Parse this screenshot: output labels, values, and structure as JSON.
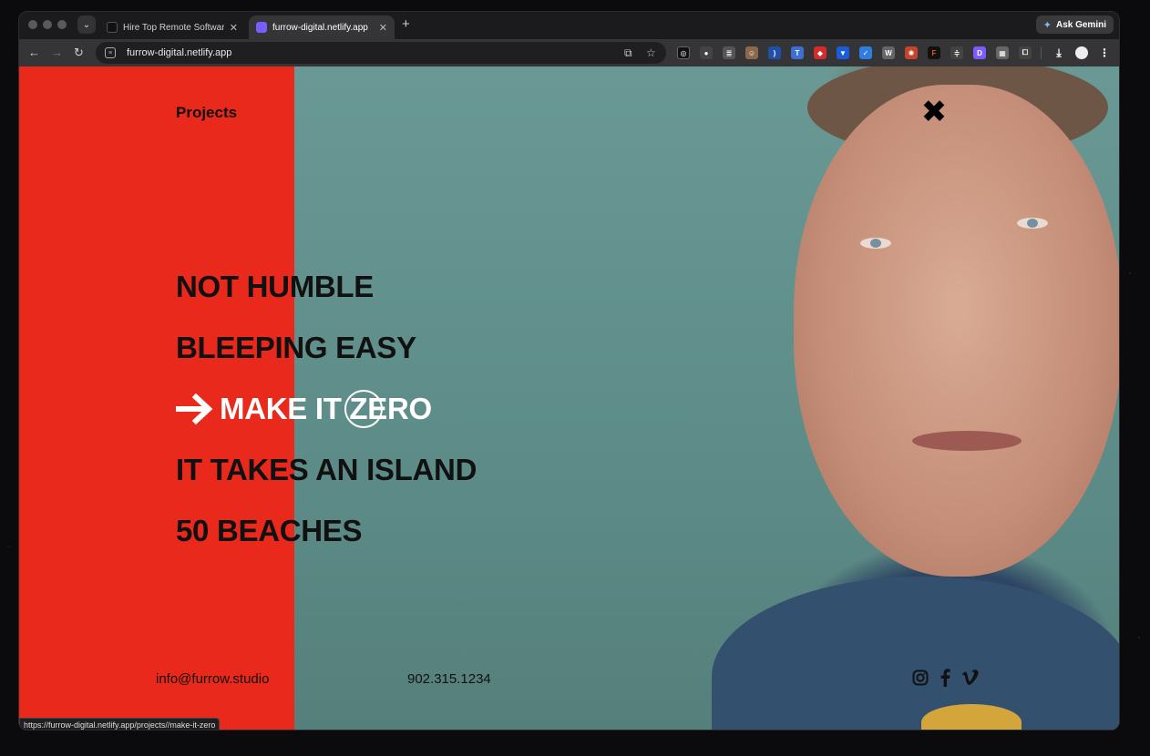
{
  "browser": {
    "tabs": [
      {
        "title": "Hire Top Remote Software De",
        "active": false
      },
      {
        "title": "furrow-digital.netlify.app",
        "active": true
      }
    ],
    "new_tab_symbol": "+",
    "tab_close_symbol": "✕",
    "gemini_label": "Ask Gemini",
    "url": "furrow-digital.netlify.app",
    "status_url": "https://furrow-digital.netlify.app/projects//make-it-zero",
    "extension_icons": [
      "chatgpt-icon",
      "toggle-icon",
      "reader-icon",
      "monkey-icon",
      "wave-icon",
      "translate-icon",
      "red-shield-icon",
      "bitwarden-icon",
      "check-icon",
      "wordpress-icon",
      "burst-icon",
      "figma-icon",
      "ruler-icon",
      "d-icon",
      "grid-icon",
      "puzzle-icon"
    ]
  },
  "page": {
    "projects_label": "Projects",
    "close_symbol": "✖",
    "menu_items": [
      {
        "label": "NOT HUMBLE",
        "active": false
      },
      {
        "label": "BLEEPING EASY",
        "active": false
      },
      {
        "label": "MAKE IT ZERO",
        "active": true
      },
      {
        "label": "IT TAKES AN ISLAND",
        "active": false
      },
      {
        "label": "50 BEACHES",
        "active": false
      }
    ],
    "arrow_symbol": "🡒",
    "email": "info@furrow.studio",
    "phone": "902.315.1234",
    "social": [
      "instagram-icon",
      "facebook-icon",
      "vimeo-icon"
    ]
  },
  "colors": {
    "red_panel": "#e8291b",
    "teal_background": "#5f8f8b",
    "text_dark": "#111111",
    "active_text": "#ffffff"
  }
}
